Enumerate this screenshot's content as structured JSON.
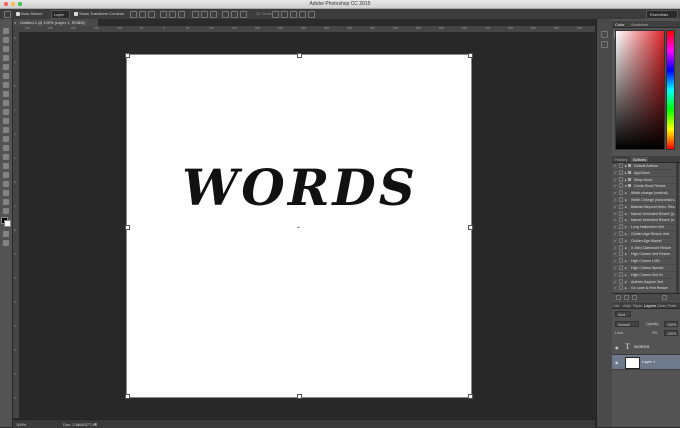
{
  "app": {
    "title": "Adobe Photoshop CC 2015",
    "workspace": "Essentials"
  },
  "options_bar": {
    "auto_select_label": "Auto-Select:",
    "auto_select_value": "Layer",
    "show_transform_label": "Show Transform Controls",
    "mode_3d_label": "3D Mode:"
  },
  "document": {
    "tab_title": "Untitled-1 @ 100% (Layer 1, RGB/8)",
    "canvas_text": "WORDS"
  },
  "ruler": {
    "top": [
      "300",
      "250",
      "200",
      "150",
      "100",
      "50",
      "0",
      "50",
      "100",
      "150",
      "200",
      "250",
      "300",
      "350",
      "400",
      "450",
      "500",
      "550",
      "600",
      "650",
      "700",
      "750",
      "800",
      "850",
      "900"
    ],
    "left": [
      "5",
      "0",
      "5",
      "1",
      "0",
      "1",
      "5",
      "2",
      "0",
      "2",
      "5",
      "3",
      "0",
      "3",
      "5",
      "4"
    ]
  },
  "status": {
    "zoom": "100%",
    "doc_size": "Doc: 2.86M/577.8K"
  },
  "panels": {
    "color_tabs": [
      "Color",
      "Swatches"
    ],
    "history_tabs": [
      "History",
      "Actions"
    ],
    "actions": [
      {
        "label": "Default Actions",
        "folder": true,
        "expanded": false
      },
      {
        "label": "AppStorm",
        "folder": true,
        "expanded": false
      },
      {
        "label": "Wrap Word",
        "folder": true,
        "expanded": false
      },
      {
        "label": "Comic Book Resize",
        "folder": true,
        "expanded": true
      },
      {
        "label": "Width change (vertical)",
        "folder": false
      },
      {
        "label": "Width Change (horizontal s...",
        "folder": false
      },
      {
        "label": "Batman Beyond Horiz. Res...",
        "folder": false
      },
      {
        "label": "Marvel Unlimited Resize (p...",
        "folder": false
      },
      {
        "label": "Marvel Unlimited Resize (s...",
        "folder": false
      },
      {
        "label": "Long Halloween Vert",
        "folder": false
      },
      {
        "label": "Golden Age Resize Vert",
        "folder": false
      },
      {
        "label": "Golden Age Marvel",
        "folder": false
      },
      {
        "label": "X-Men Claremont Resize",
        "folder": false
      },
      {
        "label": "High Crimes Vert Resize",
        "folder": false
      },
      {
        "label": "High Crimes 1353",
        "folder": false
      },
      {
        "label": "High Crimes Spread",
        "folder": false
      },
      {
        "label": "High Crimes Vert fix",
        "folder": false
      },
      {
        "label": "Anthem Asylum Vert",
        "folder": false
      },
      {
        "label": "Go Lane & Red Resize",
        "folder": false
      }
    ],
    "layers_tabs": [
      "Libr",
      "Adju",
      "Style",
      "Layers",
      "Chan",
      "Path"
    ],
    "layers_active_tab": "Layers",
    "kind_label": "Kind",
    "blend_mode": "Normal",
    "opacity_label": "Opacity:",
    "opacity_value": "100%",
    "lock_label": "Lock:",
    "fill_label": "Fill:",
    "fill_value": "100%",
    "layers": [
      {
        "name": "WORDS",
        "type": "text",
        "selected": false
      },
      {
        "name": "Layer 1",
        "type": "pixel",
        "selected": true
      }
    ]
  },
  "colors": {
    "accent": "#6e7a8c",
    "bg": "#2b2b2b",
    "foreground_swatch": "#000000",
    "background_swatch": "#ffffff"
  }
}
